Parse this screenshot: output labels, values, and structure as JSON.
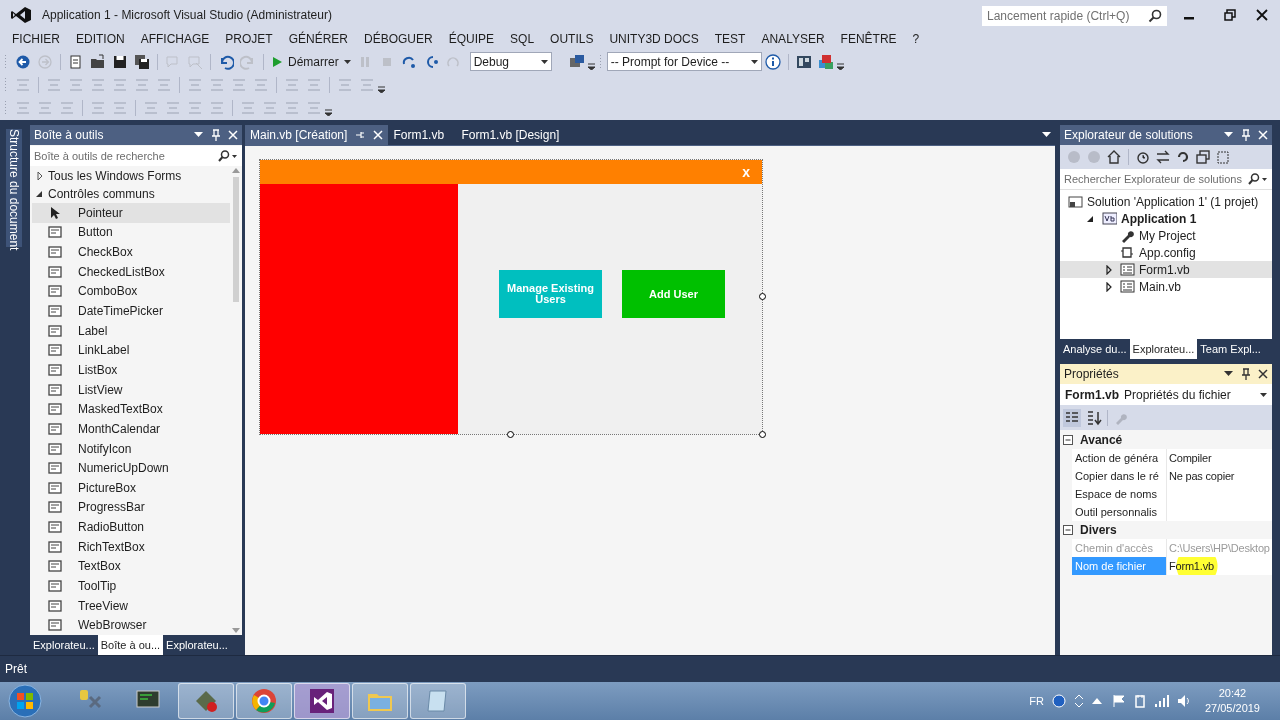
{
  "window": {
    "title": "Application 1 - Microsoft Visual Studio (Administrateur)"
  },
  "quick_launch": {
    "placeholder": "Lancement rapide (Ctrl+Q)"
  },
  "menu": [
    "FICHIER",
    "EDITION",
    "AFFICHAGE",
    "PROJET",
    "GÉNÉRER",
    "DÉBOGUER",
    "ÉQUIPE",
    "SQL",
    "OUTILS",
    "UNITY3D DOCS",
    "TEST",
    "ANALYSER",
    "FENÊTRE",
    "?"
  ],
  "toolbar": {
    "start_label": "Démarrer",
    "configuration": "Debug",
    "device": "-- Prompt for Device --"
  },
  "side_tab": "Structure du document",
  "toolbox": {
    "title": "Boîte à outils",
    "search": {
      "placeholder": "Boîte à outils de recherche"
    },
    "groups": [
      {
        "label": "Tous les Windows Forms",
        "expanded": false
      },
      {
        "label": "Contrôles communs",
        "expanded": true
      }
    ],
    "items": [
      {
        "label": "Pointeur",
        "kind": "pointer",
        "selected": true
      },
      {
        "label": "Button",
        "kind": "control",
        "selected": false
      },
      {
        "label": "CheckBox",
        "kind": "control",
        "selected": false
      },
      {
        "label": "CheckedListBox",
        "kind": "control",
        "selected": false
      },
      {
        "label": "ComboBox",
        "kind": "control",
        "selected": false
      },
      {
        "label": "DateTimePicker",
        "kind": "control",
        "selected": false
      },
      {
        "label": "Label",
        "kind": "control",
        "selected": false
      },
      {
        "label": "LinkLabel",
        "kind": "control",
        "selected": false
      },
      {
        "label": "ListBox",
        "kind": "control",
        "selected": false
      },
      {
        "label": "ListView",
        "kind": "control",
        "selected": false
      },
      {
        "label": "MaskedTextBox",
        "kind": "control",
        "selected": false
      },
      {
        "label": "MonthCalendar",
        "kind": "control",
        "selected": false
      },
      {
        "label": "NotifyIcon",
        "kind": "control",
        "selected": false
      },
      {
        "label": "NumericUpDown",
        "kind": "control",
        "selected": false
      },
      {
        "label": "PictureBox",
        "kind": "control",
        "selected": false
      },
      {
        "label": "ProgressBar",
        "kind": "control",
        "selected": false
      },
      {
        "label": "RadioButton",
        "kind": "control",
        "selected": false
      },
      {
        "label": "RichTextBox",
        "kind": "control",
        "selected": false
      },
      {
        "label": "TextBox",
        "kind": "control",
        "selected": false
      },
      {
        "label": "ToolTip",
        "kind": "control",
        "selected": false
      },
      {
        "label": "TreeView",
        "kind": "control",
        "selected": false
      },
      {
        "label": "WebBrowser",
        "kind": "control",
        "selected": false
      }
    ],
    "tabs": [
      {
        "label": "Explorateu...",
        "selected": false
      },
      {
        "label": "Boîte à ou...",
        "selected": true
      },
      {
        "label": "Explorateu...",
        "selected": false
      }
    ]
  },
  "editor": {
    "tabs": [
      {
        "label": "Main.vb [Création]",
        "selected": true
      },
      {
        "label": "Form1.vb",
        "selected": false
      },
      {
        "label": "Form1.vb [Design]",
        "selected": false
      }
    ],
    "form": {
      "close": "x",
      "buttons": [
        {
          "label": "Manage Existing Users",
          "color": "#00bfbf"
        },
        {
          "label": "Add User",
          "color": "#00c000"
        }
      ]
    }
  },
  "solution_explorer": {
    "title": "Explorateur de solutions",
    "search": {
      "placeholder": "Rechercher Explorateur de solutions"
    },
    "tree": [
      {
        "label": "Solution 'Application 1' (1 projet)",
        "kind": "solution",
        "selected": false,
        "children": [
          {
            "label": "Application 1",
            "kind": "project",
            "expanded": true,
            "selected": false,
            "children": [
              {
                "label": "My Project",
                "kind": "wrench",
                "selected": false
              },
              {
                "label": "App.config",
                "kind": "config",
                "selected": false
              },
              {
                "label": "Form1.vb",
                "kind": "form",
                "expanded": false,
                "selected": true
              },
              {
                "label": "Main.vb",
                "kind": "form",
                "expanded": false,
                "selected": false
              }
            ]
          }
        ]
      }
    ],
    "tabs": [
      {
        "label": "Analyse du...",
        "selected": false
      },
      {
        "label": "Explorateu...",
        "selected": true
      },
      {
        "label": "Team Expl...",
        "selected": false
      }
    ]
  },
  "properties": {
    "title": "Propriétés",
    "object": "Form1.vb",
    "object_type": "Propriétés du fichier",
    "categories": [
      {
        "label": "Avancé",
        "expanded": true,
        "rows": [
          {
            "name": "Action de généra",
            "value": "Compiler",
            "disabled": false,
            "selected": false
          },
          {
            "name": "Copier dans le ré",
            "value": "Ne pas copier",
            "disabled": false,
            "selected": false
          },
          {
            "name": "Espace de noms",
            "disabled": false,
            "selected": false
          },
          {
            "name": "Outil personnalis",
            "disabled": false,
            "selected": false
          }
        ]
      },
      {
        "label": "Divers",
        "expanded": true,
        "rows": [
          {
            "name": "Chemin d'accès",
            "value": "C:\\Users\\HP\\Desktop",
            "disabled": true,
            "selected": false
          },
          {
            "name": "Nom de fichier",
            "value": "Form1.vb",
            "disabled": false,
            "selected": true
          }
        ]
      }
    ]
  },
  "status_bar": {
    "text": "Prêt"
  },
  "taskbar": {
    "apps": [
      {
        "kind": "tools",
        "open": false,
        "selected": false
      },
      {
        "kind": "monitor",
        "open": false,
        "selected": false
      },
      {
        "kind": "game",
        "open": true,
        "selected": false
      },
      {
        "kind": "browser",
        "open": true,
        "selected": false
      },
      {
        "kind": "studio",
        "open": true,
        "selected": true
      },
      {
        "kind": "folder",
        "open": true,
        "selected": false
      },
      {
        "kind": "notepad",
        "open": true,
        "selected": false
      }
    ],
    "language": "FR",
    "time": "20:42",
    "date": "27/05/2019"
  }
}
